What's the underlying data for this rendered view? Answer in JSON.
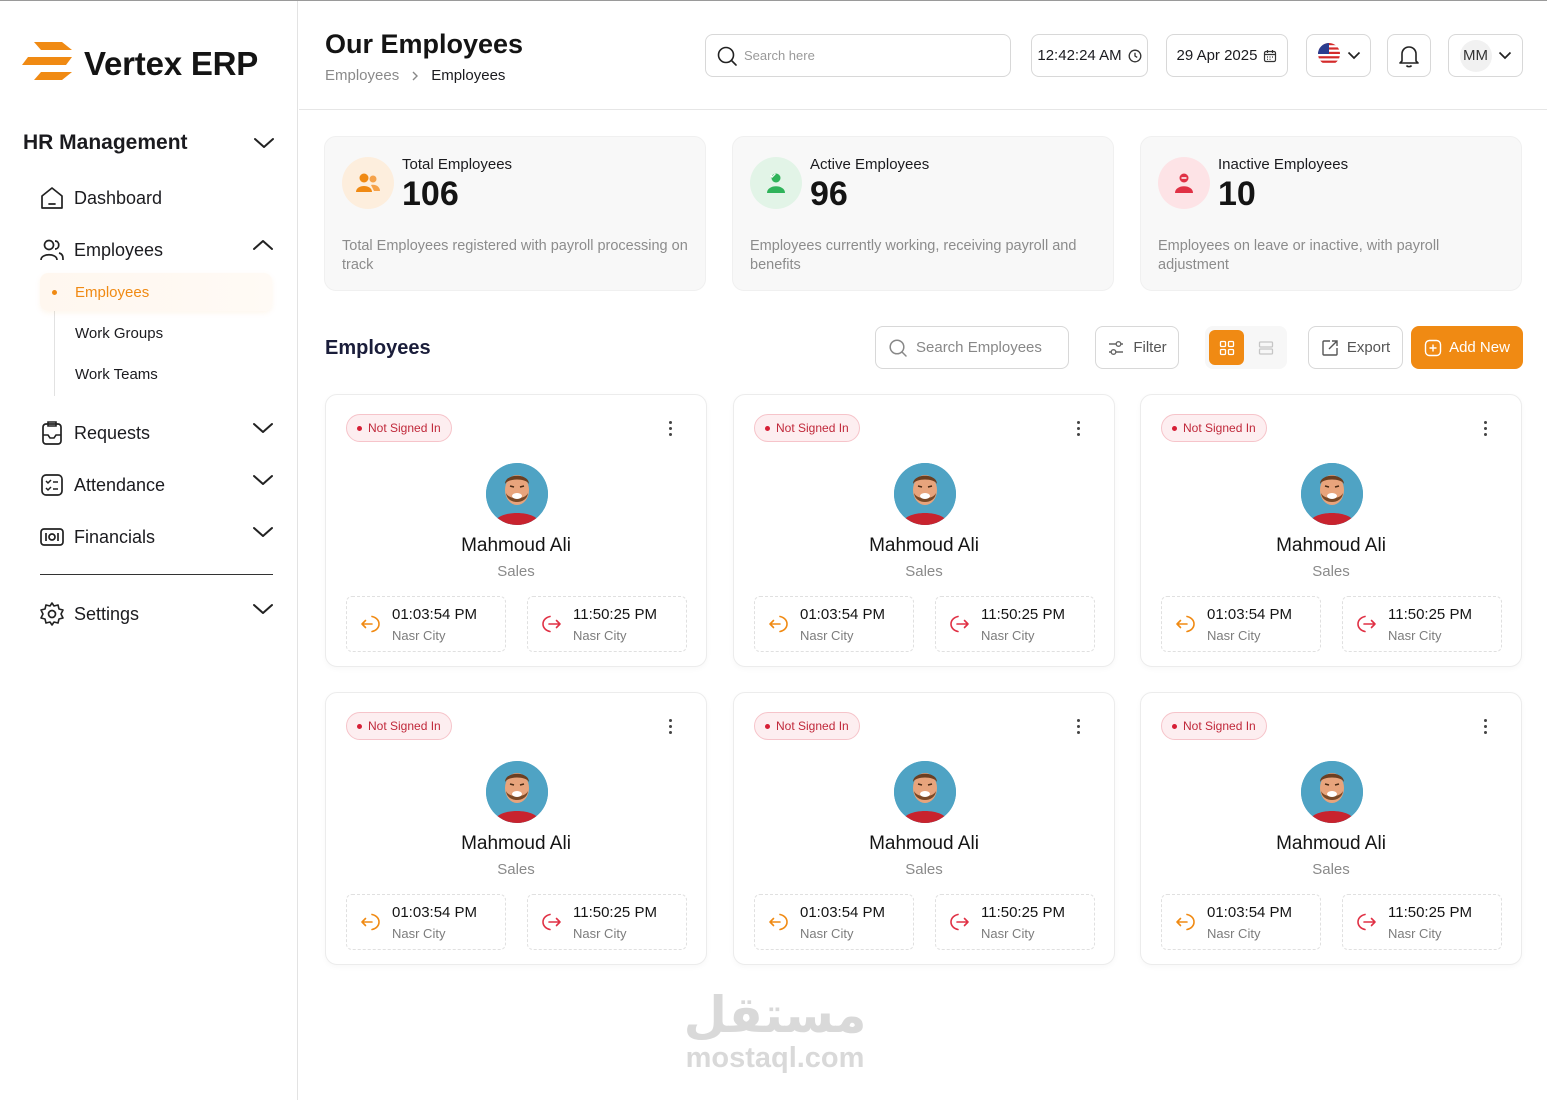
{
  "app": {
    "name": "Vertex ERP"
  },
  "sidebar": {
    "section": "HR Management",
    "items": [
      {
        "label": "Dashboard"
      },
      {
        "label": "Employees"
      },
      {
        "label": "Requests"
      },
      {
        "label": "Attendance"
      },
      {
        "label": "Financials"
      },
      {
        "label": "Settings"
      }
    ],
    "employee_sub": [
      {
        "label": "Employees"
      },
      {
        "label": "Work Groups"
      },
      {
        "label": "Work Teams"
      }
    ]
  },
  "header": {
    "title": "Our Employees",
    "breadcrumb": [
      "Employees",
      "Employees"
    ],
    "search_placeholder": "Search here",
    "time": "12:42:24 AM",
    "date": "29 Apr 2025",
    "user_initials": "MM"
  },
  "stats": [
    {
      "label": "Total Employees",
      "value": "106",
      "desc": "Total Employees registered with payroll processing on track",
      "color": "#f08a13"
    },
    {
      "label": "Active Employees",
      "value": "96",
      "desc": "Employees currently working, receiving payroll and benefits",
      "color": "#2fb35a"
    },
    {
      "label": "Inactive Employees",
      "value": "10",
      "desc": "Employees on leave or inactive, with payroll adjustment",
      "color": "#e03145"
    }
  ],
  "employees_section": {
    "title": "Employees",
    "search_placeholder": "Search Employees",
    "filter_label": "Filter",
    "export_label": "Export",
    "add_label": "Add New"
  },
  "employees": [
    {
      "status": "Not Signed In",
      "name": "Mahmoud Ali",
      "dept": "Sales",
      "in_time": "01:03:54 PM",
      "in_loc": "Nasr City",
      "out_time": "11:50:25 PM",
      "out_loc": "Nasr City"
    },
    {
      "status": "Not Signed In",
      "name": "Mahmoud Ali",
      "dept": "Sales",
      "in_time": "01:03:54 PM",
      "in_loc": "Nasr City",
      "out_time": "11:50:25 PM",
      "out_loc": "Nasr City"
    },
    {
      "status": "Not Signed In",
      "name": "Mahmoud Ali",
      "dept": "Sales",
      "in_time": "01:03:54 PM",
      "in_loc": "Nasr City",
      "out_time": "11:50:25 PM",
      "out_loc": "Nasr City"
    },
    {
      "status": "Not Signed In",
      "name": "Mahmoud Ali",
      "dept": "Sales",
      "in_time": "01:03:54 PM",
      "in_loc": "Nasr City",
      "out_time": "11:50:25 PM",
      "out_loc": "Nasr City"
    },
    {
      "status": "Not Signed In",
      "name": "Mahmoud Ali",
      "dept": "Sales",
      "in_time": "01:03:54 PM",
      "in_loc": "Nasr City",
      "out_time": "11:50:25 PM",
      "out_loc": "Nasr City"
    },
    {
      "status": "Not Signed In",
      "name": "Mahmoud Ali",
      "dept": "Sales",
      "in_time": "01:03:54 PM",
      "in_loc": "Nasr City",
      "out_time": "11:50:25 PM",
      "out_loc": "Nasr City"
    }
  ],
  "watermark": {
    "arabic": "مستقل",
    "latin": "mostaql.com"
  },
  "colors": {
    "accent": "#f08a13",
    "danger": "#e03145",
    "success": "#2fb35a"
  }
}
